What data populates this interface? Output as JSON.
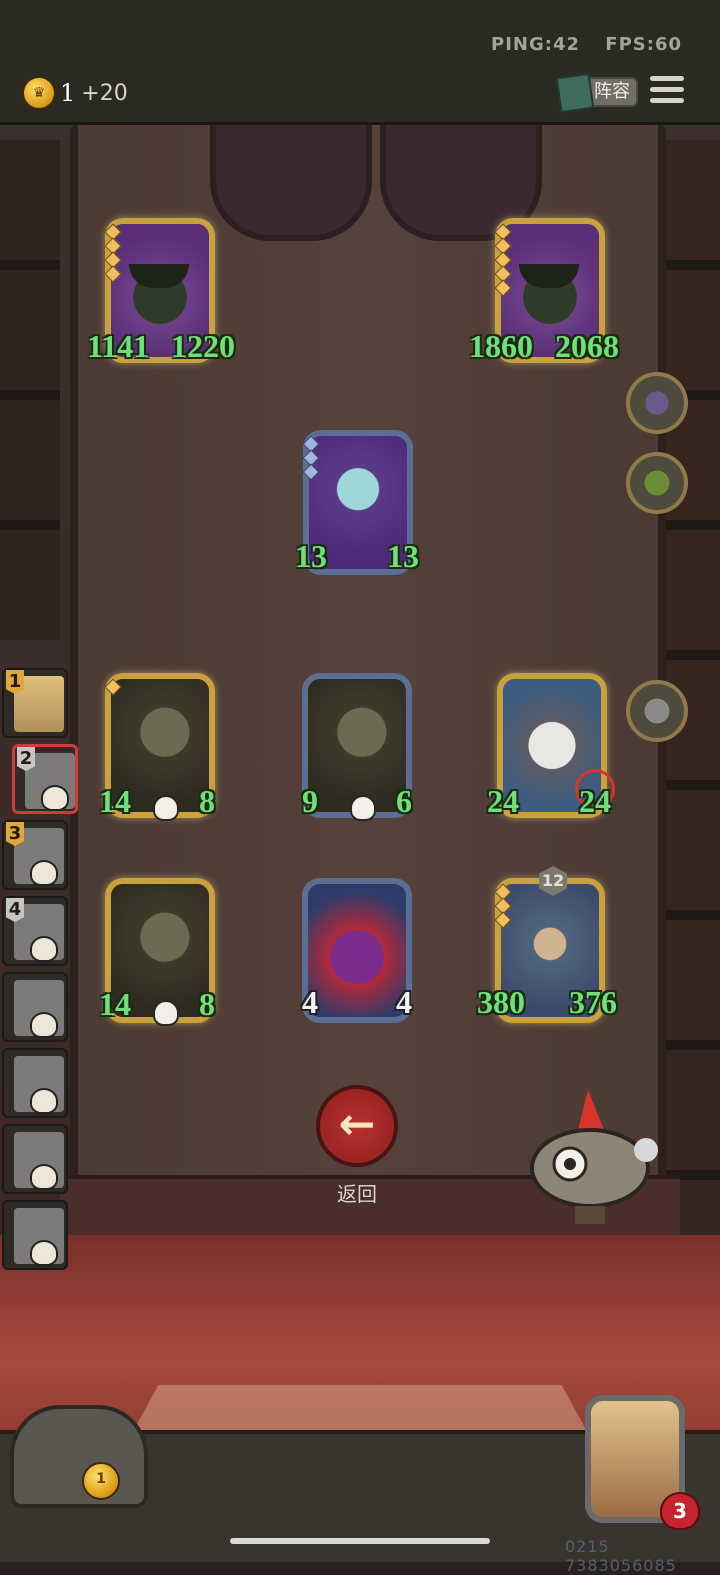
{
  "hud": {
    "ping_label": "PING:42",
    "fps_label": "FPS:60",
    "coins": "1",
    "coins_income": "+20",
    "lineup_label": "阵容",
    "menu_icon": "hamburger-menu-icon"
  },
  "enemy_board": [
    {
      "name": "plant-monster",
      "attack": "1141",
      "health": "1220",
      "tier_gems": 4
    },
    {
      "name": "plant-monster",
      "attack": "1860",
      "health": "2068",
      "tier_gems": 5
    }
  ],
  "enemy_hero": {
    "attack": "13",
    "health": "13",
    "tier_gems": 3
  },
  "player_board": [
    {
      "name": "witch-gunner",
      "attack": "14",
      "health": "8",
      "skull": true,
      "golden": true
    },
    {
      "name": "witch-gunner",
      "attack": "9",
      "health": "6",
      "skull": true,
      "golden": false
    },
    {
      "name": "husky-dog",
      "attack": "24",
      "health": "24",
      "target": true,
      "golden": true
    },
    {
      "name": "witch-gunner",
      "attack": "14",
      "health": "8",
      "skull": true,
      "golden": true
    },
    {
      "name": "clown",
      "attack": "4",
      "health": "4",
      "golden": false
    },
    {
      "name": "knight",
      "attack": "380",
      "health": "376",
      "level_badge": "12",
      "golden": true
    }
  ],
  "side_icons": [
    "voodoo-doll-icon",
    "bonsai-tree-icon",
    "robot-icon"
  ],
  "player_list": [
    {
      "rank": "1",
      "alive": true
    },
    {
      "rank": "2",
      "alive": false,
      "active": true
    },
    {
      "rank": "3",
      "alive": false
    },
    {
      "rank": "4",
      "alive": false
    },
    {
      "rank": "",
      "alive": false
    },
    {
      "rank": "",
      "alive": false
    },
    {
      "rank": "",
      "alive": false
    },
    {
      "rank": "",
      "alive": false
    }
  ],
  "back_button": {
    "label": "返回"
  },
  "chest": {
    "coin_count": "1"
  },
  "hero": {
    "health": "3"
  },
  "footer": {
    "id_text": "0215 7383056085"
  },
  "colors": {
    "golden_frame": "#c9a13d",
    "blue_frame": "#5c6e93",
    "stat_green": "#6fe07b",
    "back_red": "#b8322d"
  }
}
